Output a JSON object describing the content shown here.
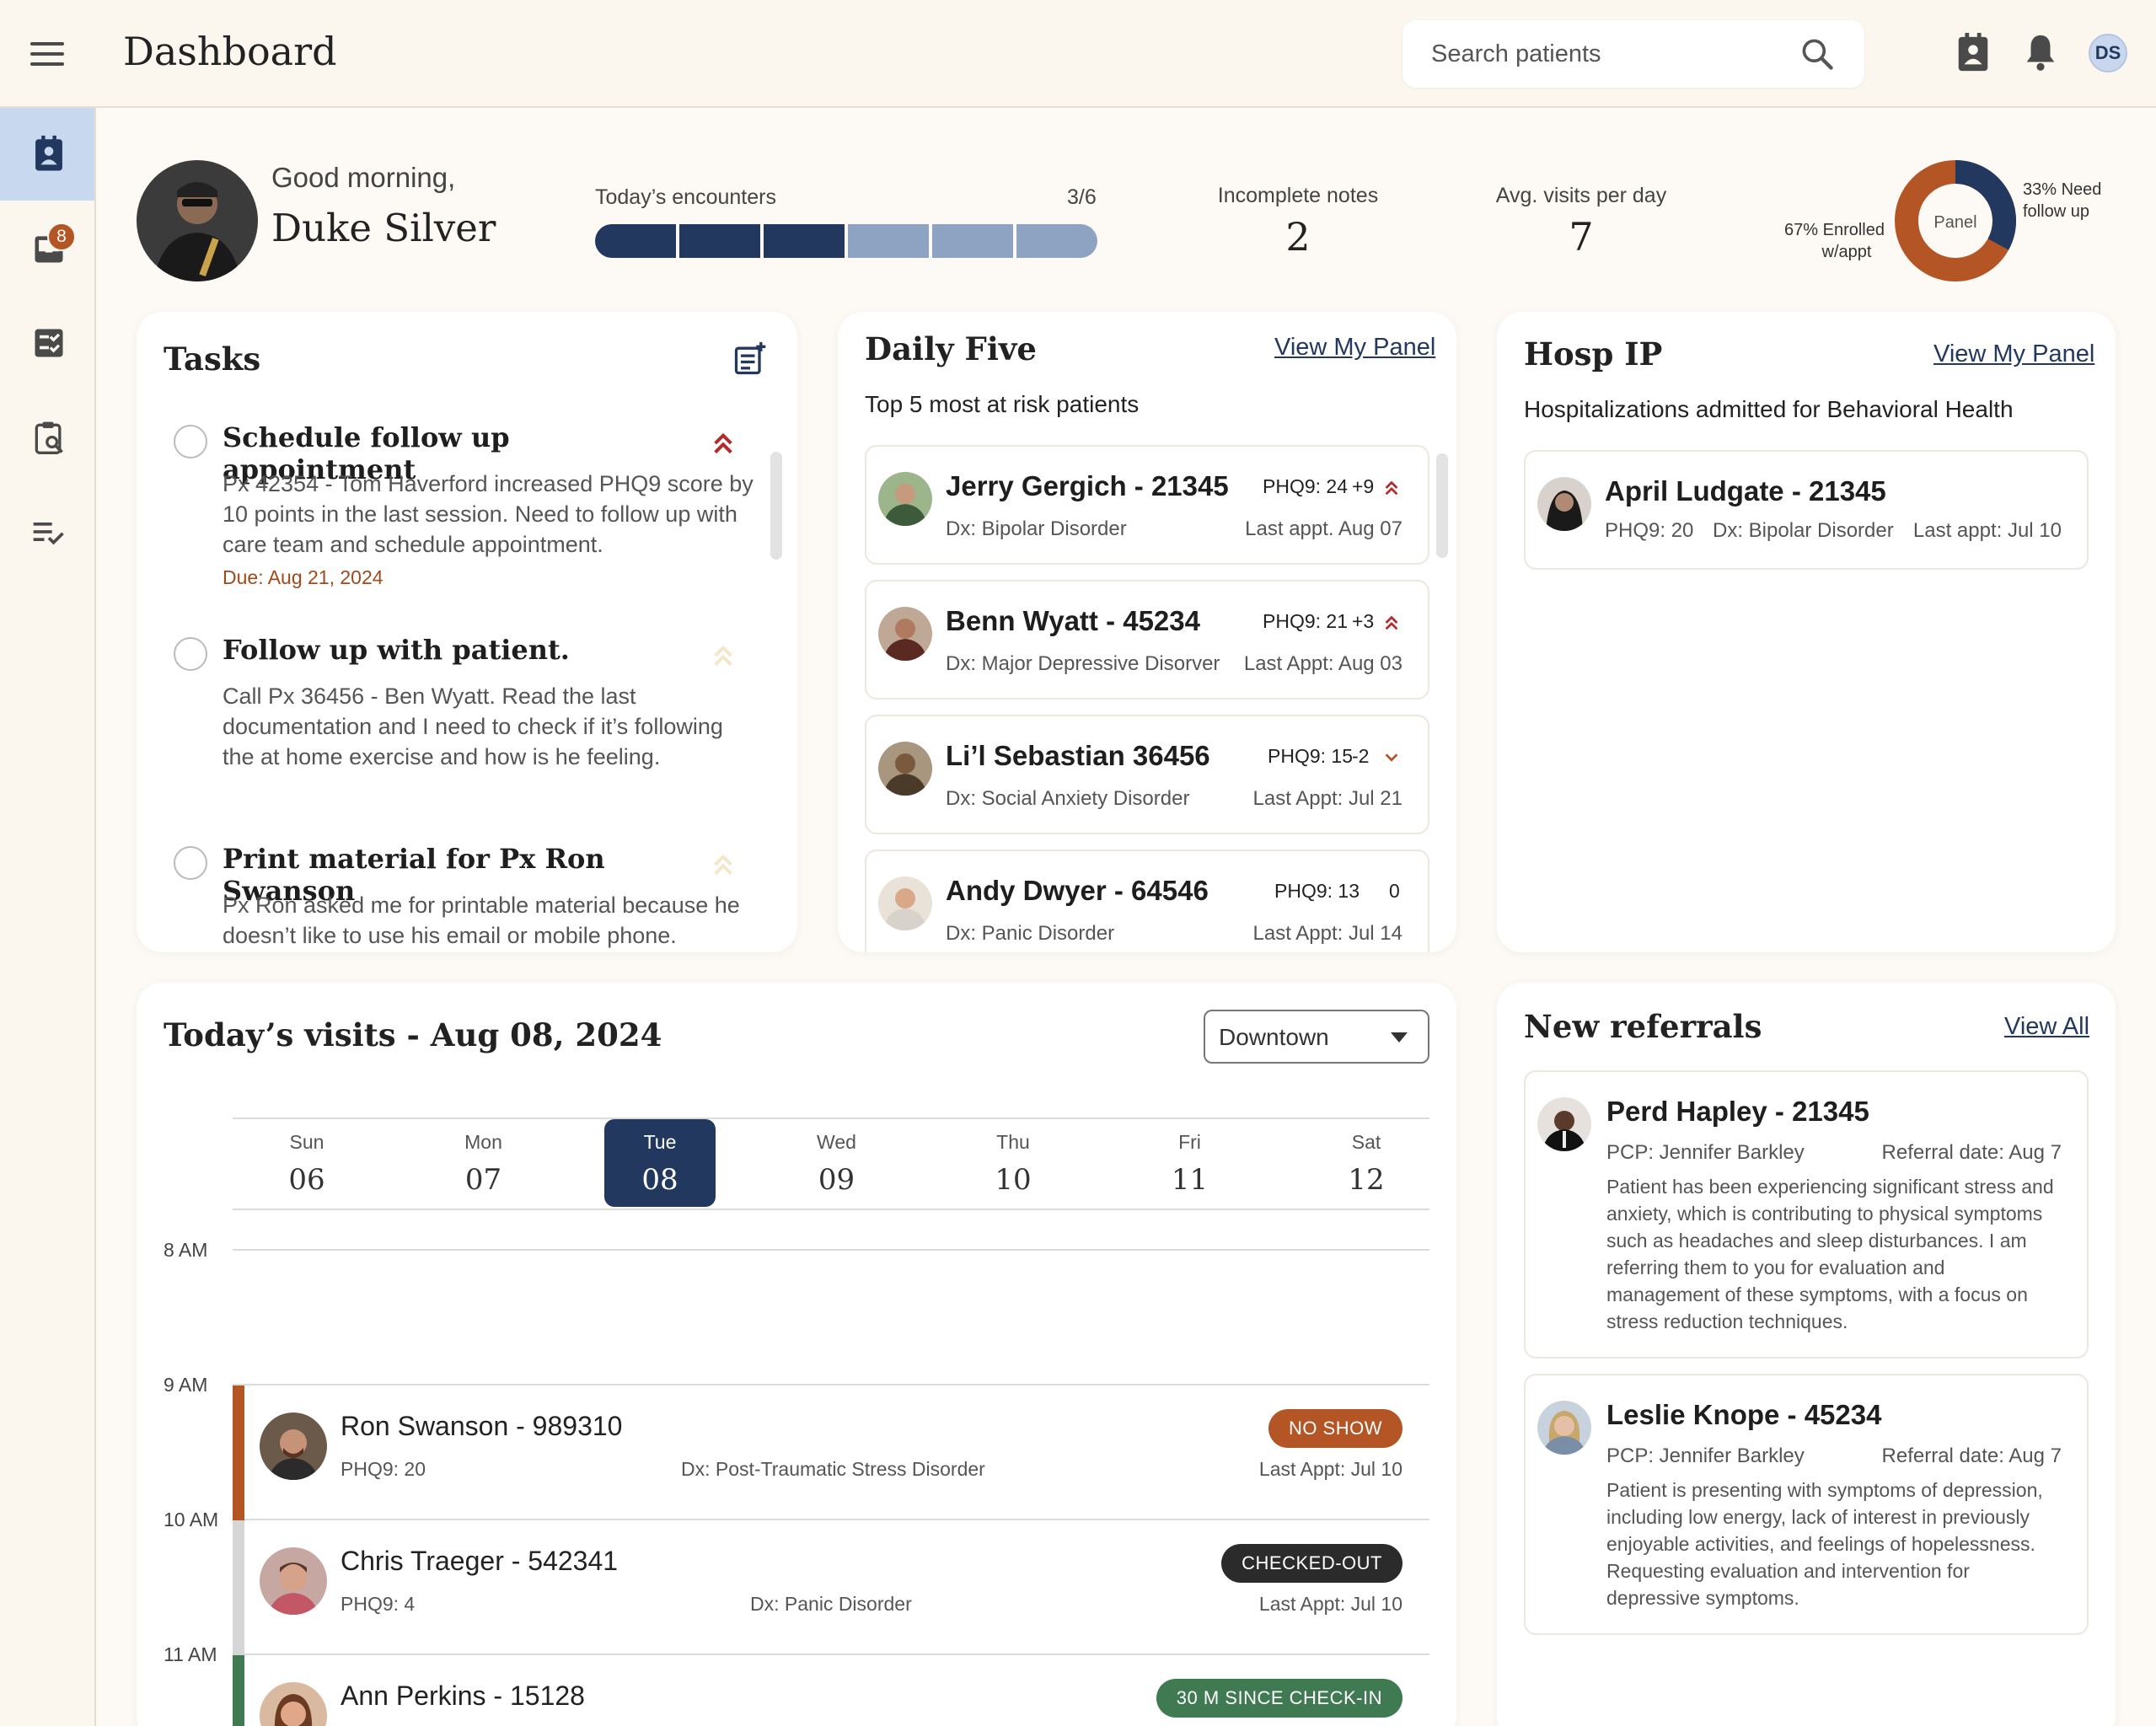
{
  "header": {
    "title": "Dashboard",
    "search_placeholder": "Search patients",
    "user_initials": "DS"
  },
  "rail": {
    "badge_count": "8",
    "items": [
      "patients-icon",
      "inbox-icon",
      "tasks-icon",
      "clipboard-search-icon",
      "checklist-icon"
    ]
  },
  "greeting": {
    "salutation": "Good morning,",
    "name": "Duke Silver"
  },
  "encounters": {
    "label": "Today’s encounters",
    "count": "3/6",
    "completed": 3,
    "total": 6
  },
  "stats": {
    "incomplete_label": "Incomplete notes",
    "incomplete_value": "2",
    "avg_label": "Avg. visits per day",
    "avg_value": "7"
  },
  "panel_donut": {
    "center_label": "Panel",
    "enrolled_label_1": "67% Enrolled",
    "enrolled_label_2": "w/appt",
    "followup_label_1": "33% Need",
    "followup_label_2": "follow up",
    "enrolled_pct": 67,
    "followup_pct": 33,
    "colors": {
      "enrolled": "#b45525",
      "followup": "#22385e"
    }
  },
  "tasks": {
    "title": "Tasks",
    "items": [
      {
        "title": "Schedule follow up appointment",
        "desc": "Px 42354 - Tom Haverford increased PHQ9 score by 10 points in the last session. Need to follow up with care team and schedule appointment.",
        "due": "Due: Aug 21, 2024"
      },
      {
        "title": "Follow up with patient.",
        "desc": "Call Px 36456 - Ben Wyatt. Read the last documentation and I need to check if it’s following the at home exercise and how is he feeling."
      },
      {
        "title": "Print material for Px Ron Swanson",
        "desc": "Px Ron asked me for printable material because he doesn’t like to use his email or mobile phone."
      }
    ]
  },
  "daily_five": {
    "title": "Daily Five",
    "link": "View My Panel",
    "subtitle": "Top 5 most at risk patients",
    "patients": [
      {
        "name": "Jerry Gergich - 21345",
        "phq": "PHQ9: 24",
        "change": "+9",
        "trend": "up",
        "dx": "Dx: Bipolar Disorder",
        "last": "Last appt. Aug 07"
      },
      {
        "name": "Benn Wyatt - 45234",
        "phq": "PHQ9: 21",
        "change": "+3",
        "trend": "up",
        "dx": "Dx: Major Depressive Disorver",
        "last": "Last Appt: Aug 03"
      },
      {
        "name": "Li’l Sebastian 36456",
        "phq": "PHQ9: 15",
        "change": "-2",
        "trend": "down",
        "dx": "Dx: Social Anxiety Disorder",
        "last": "Last Appt: Jul 21"
      },
      {
        "name": "Andy Dwyer - 64546",
        "phq": "PHQ9: 13",
        "change": "0",
        "trend": "none",
        "dx": "Dx: Panic Disorder",
        "last": "Last Appt: Jul 14"
      }
    ]
  },
  "hosp_ip": {
    "title": "Hosp IP",
    "link": "View My Panel",
    "subtitle": "Hospitalizations admitted for Behavioral Health",
    "patients": [
      {
        "name": "April Ludgate - 21345",
        "phq": "PHQ9: 20",
        "dx": "Dx: Bipolar Disorder",
        "last": "Last appt: Jul 10"
      }
    ]
  },
  "visits": {
    "title": "Today’s visits - Aug 08, 2024",
    "location": "Downtown",
    "days": [
      {
        "name": "Sun",
        "date": "06"
      },
      {
        "name": "Mon",
        "date": "07"
      },
      {
        "name": "Tue",
        "date": "08"
      },
      {
        "name": "Wed",
        "date": "09"
      },
      {
        "name": "Thu",
        "date": "10"
      },
      {
        "name": "Fri",
        "date": "11"
      },
      {
        "name": "Sat",
        "date": "12"
      }
    ],
    "selected_day": "Tue",
    "hours": [
      "8 AM",
      "9 AM",
      "10 AM",
      "11 AM"
    ],
    "appointments": [
      {
        "name": "Ron Swanson - 989310",
        "phq": "PHQ9: 20",
        "dx": "Dx: Post-Traumatic Stress Disorder",
        "last": "Last Appt: Jul 10",
        "status": "NO SHOW",
        "status_color": "#b45525",
        "bar_color": "#b45525"
      },
      {
        "name": "Chris Traeger - 542341",
        "phq": "PHQ9: 4",
        "dx": "Dx: Panic Disorder",
        "last": "Last Appt: Jul 10",
        "status": "CHECKED-OUT",
        "status_color": "#2b2b2b",
        "bar_color": "#d6d6d6"
      },
      {
        "name": "Ann Perkins - 15128",
        "status": "30 M SINCE CHECK-IN",
        "status_color": "#3f7a52",
        "bar_color": "#3f7a52"
      }
    ]
  },
  "referrals": {
    "title": "New referrals",
    "link": "View All",
    "items": [
      {
        "name": "Perd Hapley - 21345",
        "pcp": "PCP: Jennifer Barkley",
        "date": "Referral date: Aug 7",
        "note": "Patient has been experiencing significant stress and anxiety, which is contributing to physical symptoms such as headaches and sleep disturbances. I am referring them to you for evaluation and management of these symptoms, with a focus on stress reduction techniques."
      },
      {
        "name": "Leslie Knope - 45234",
        "pcp": "PCP: Jennifer Barkley",
        "date": "Referral date: Aug 7",
        "note": "Patient is presenting with symptoms of depression, including low energy, lack of interest in previously enjoyable activities, and feelings of hopelessness. Requesting evaluation and intervention for depressive symptoms."
      }
    ]
  }
}
